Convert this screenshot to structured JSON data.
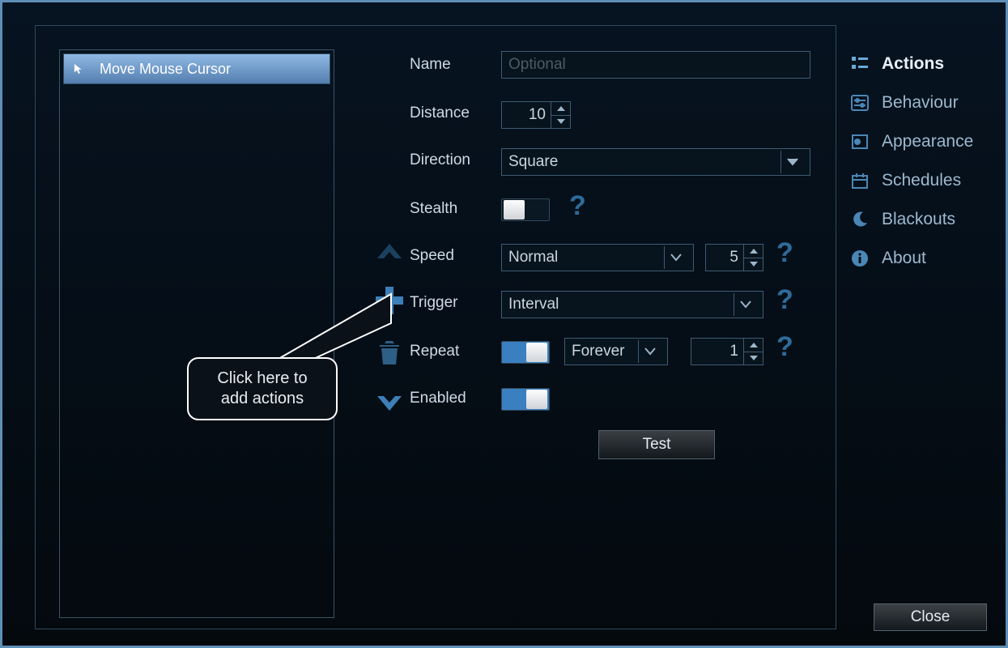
{
  "actions": {
    "items": [
      {
        "label": "Move Mouse Cursor"
      }
    ]
  },
  "form": {
    "name": {
      "label": "Name",
      "placeholder": "Optional",
      "value": ""
    },
    "distance": {
      "label": "Distance",
      "value": "10"
    },
    "direction": {
      "label": "Direction",
      "selected": "Square"
    },
    "stealth": {
      "label": "Stealth",
      "on": false
    },
    "speed": {
      "label": "Speed",
      "selected": "Normal",
      "value": "5"
    },
    "trigger": {
      "label": "Trigger",
      "selected": "Interval"
    },
    "repeat": {
      "label": "Repeat",
      "on": true,
      "mode": "Forever",
      "count": "1"
    },
    "enabled": {
      "label": "Enabled",
      "on": true
    },
    "test_label": "Test"
  },
  "sidebar": {
    "items": [
      {
        "label": "Actions",
        "active": true
      },
      {
        "label": "Behaviour",
        "active": false
      },
      {
        "label": "Appearance",
        "active": false
      },
      {
        "label": "Schedules",
        "active": false
      },
      {
        "label": "Blackouts",
        "active": false
      },
      {
        "label": "About",
        "active": false
      }
    ]
  },
  "tooltip": {
    "line1": "Click here to",
    "line2": "add actions"
  },
  "footer": {
    "close_label": "Close"
  }
}
